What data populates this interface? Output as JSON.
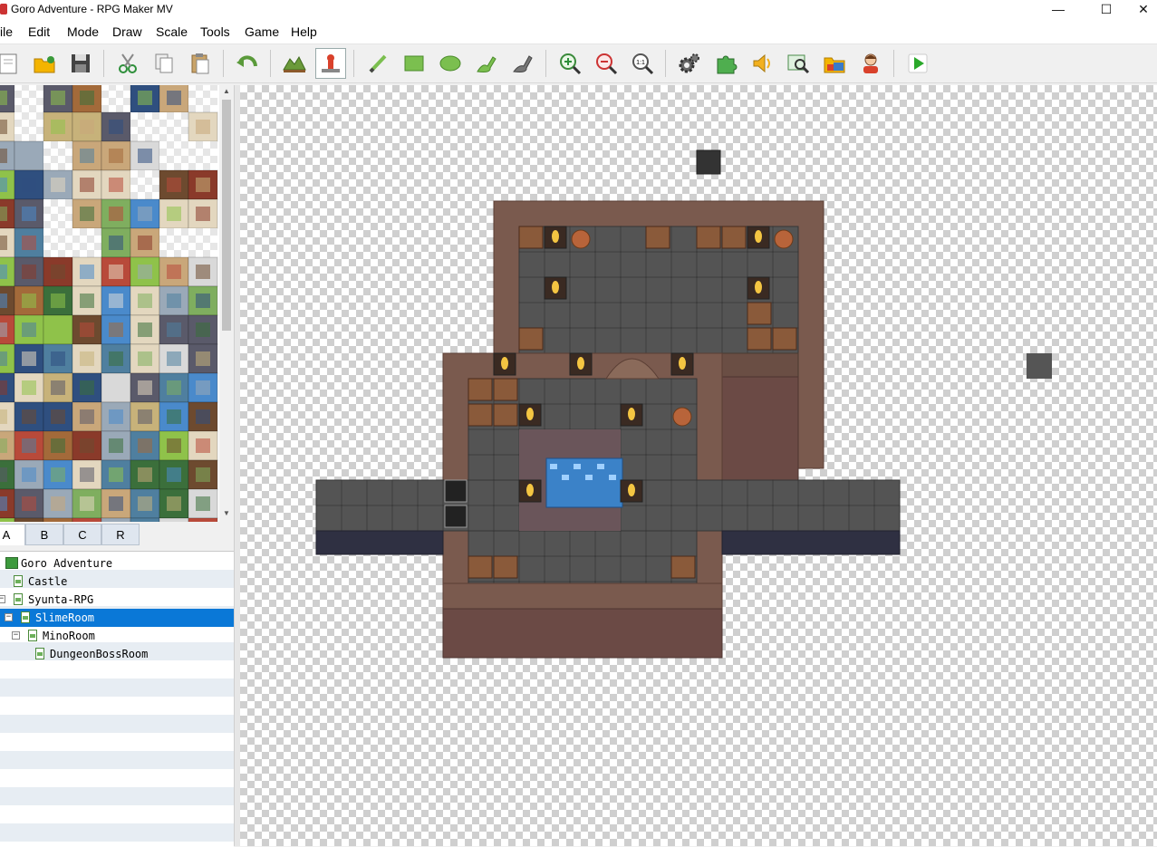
{
  "window": {
    "title": "Goro Adventure - RPG Maker MV",
    "minimize": "—",
    "maximize": "☐",
    "close": "✕"
  },
  "menu": [
    "ile",
    "Edit",
    "Mode",
    "Draw",
    "Scale",
    "Tools",
    "Game",
    "Help"
  ],
  "toolbar": [
    {
      "icon": "new-project-icon"
    },
    {
      "icon": "open-project-icon"
    },
    {
      "icon": "save-project-icon"
    },
    {
      "icon": "cut-icon"
    },
    {
      "icon": "copy-icon"
    },
    {
      "icon": "paste-icon"
    },
    {
      "icon": "undo-icon"
    },
    {
      "icon": "map-mode-icon"
    },
    {
      "icon": "event-mode-icon",
      "active": true
    },
    {
      "icon": "pencil-icon"
    },
    {
      "icon": "rectangle-icon"
    },
    {
      "icon": "ellipse-icon"
    },
    {
      "icon": "fill-icon"
    },
    {
      "icon": "shadow-pen-icon"
    },
    {
      "icon": "zoom-in-icon"
    },
    {
      "icon": "zoom-out-icon"
    },
    {
      "icon": "actual-size-icon",
      "text": "1:1"
    },
    {
      "icon": "database-icon"
    },
    {
      "icon": "plugin-manager-icon"
    },
    {
      "icon": "sound-test-icon"
    },
    {
      "icon": "event-searcher-icon"
    },
    {
      "icon": "resource-manager-icon"
    },
    {
      "icon": "character-generator-icon"
    },
    {
      "icon": "playtest-icon"
    }
  ],
  "tileset_tabs": [
    "A",
    "B",
    "C",
    "R"
  ],
  "active_tab": "A",
  "map_tree": [
    {
      "label": "Goro Adventure",
      "type": "project"
    },
    {
      "label": "Castle",
      "type": "map"
    },
    {
      "label": "Syunta-RPG",
      "type": "map",
      "toggle": "−"
    },
    {
      "label": "SlimeRoom",
      "type": "map",
      "toggle": "−",
      "selected": true
    },
    {
      "label": "MinoRoom",
      "type": "map",
      "toggle": "−"
    },
    {
      "label": "DungeonBossRoom",
      "type": "map"
    }
  ],
  "colors": {
    "selection": "#0a78d7",
    "floor": "#545454",
    "wall_brown": "#7a5a4e",
    "water": "#3b82c8",
    "torch": "#f4c542",
    "playtest_green": "#2aa82a"
  }
}
